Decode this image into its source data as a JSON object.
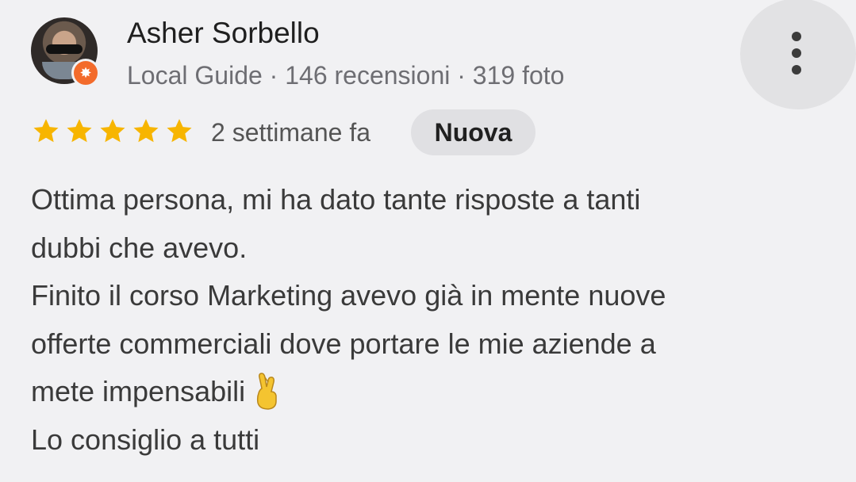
{
  "reviewer": {
    "name": "Asher Sorbello",
    "meta": "Local Guide · 146 recensioni · 319 foto"
  },
  "rating": {
    "stars": 5,
    "max": 5,
    "color": "#f7b500"
  },
  "time_ago": "2 settimane fa",
  "badge": "Nuova",
  "review": {
    "lines": [
      "Ottima persona, mi ha dato tante risposte a tanti",
      "dubbi che avevo.",
      "Finito il corso Marketing avevo già in mente nuove",
      "offerte commerciali dove portare le mie aziende a",
      "mete impensabili",
      "Lo consiglio a tutti"
    ]
  },
  "icons": {
    "menu": "more-vert-icon",
    "guide": "local-guide-icon",
    "emoji": "crossed-fingers-emoji"
  }
}
